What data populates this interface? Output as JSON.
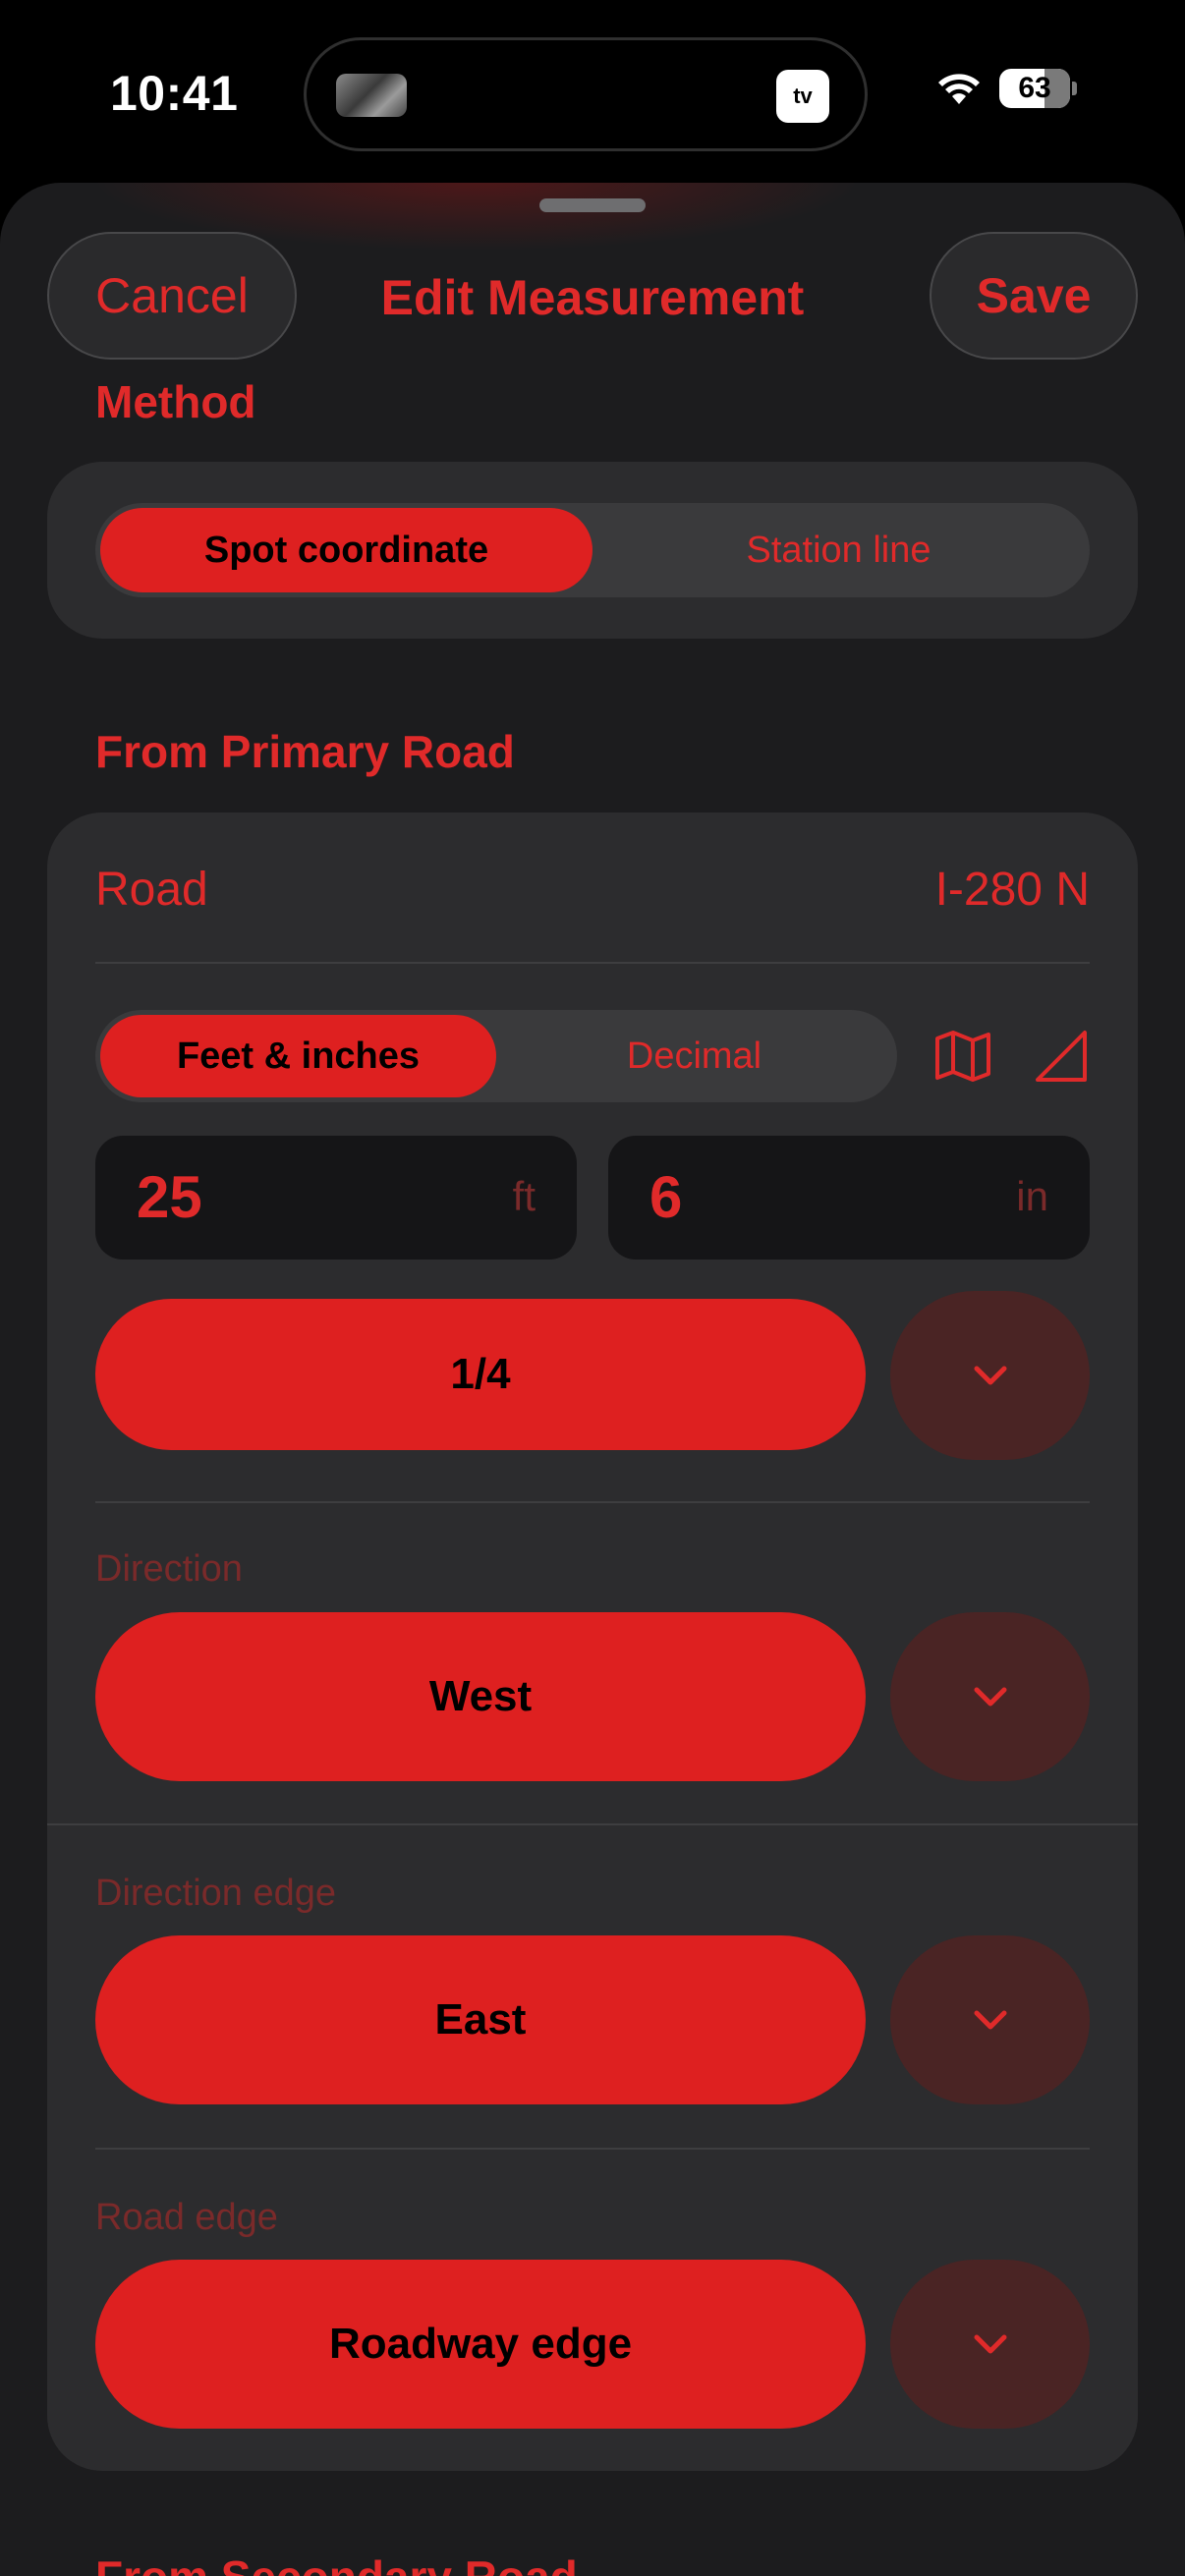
{
  "status": {
    "time": "10:41",
    "battery": "63",
    "island_app": "tv"
  },
  "nav": {
    "cancel": "Cancel",
    "title": "Edit Measurement",
    "save": "Save"
  },
  "method": {
    "label": "Method",
    "options": [
      "Spot coordinate",
      "Station line"
    ],
    "selected": "Spot coordinate"
  },
  "primary": {
    "section_label": "From Primary Road",
    "road_label": "Road",
    "road_value": "I-280 N",
    "units": {
      "options": [
        "Feet & inches",
        "Decimal"
      ],
      "selected": "Feet & inches"
    },
    "icons": [
      "map-icon",
      "triangle-icon"
    ],
    "feet_value": "25",
    "feet_unit": "ft",
    "inches_value": "6",
    "inches_unit": "in",
    "fraction": "1/4",
    "direction_label": "Direction",
    "direction_value": "West",
    "direction_edge_label": "Direction edge",
    "direction_edge_value": "East",
    "road_edge_label": "Road edge",
    "road_edge_value": "Roadway edge"
  },
  "secondary": {
    "section_label": "From Secondary Road"
  },
  "colors": {
    "accent": "#de2020",
    "sheet": "#1c1c1e",
    "card": "#2c2c2e"
  }
}
